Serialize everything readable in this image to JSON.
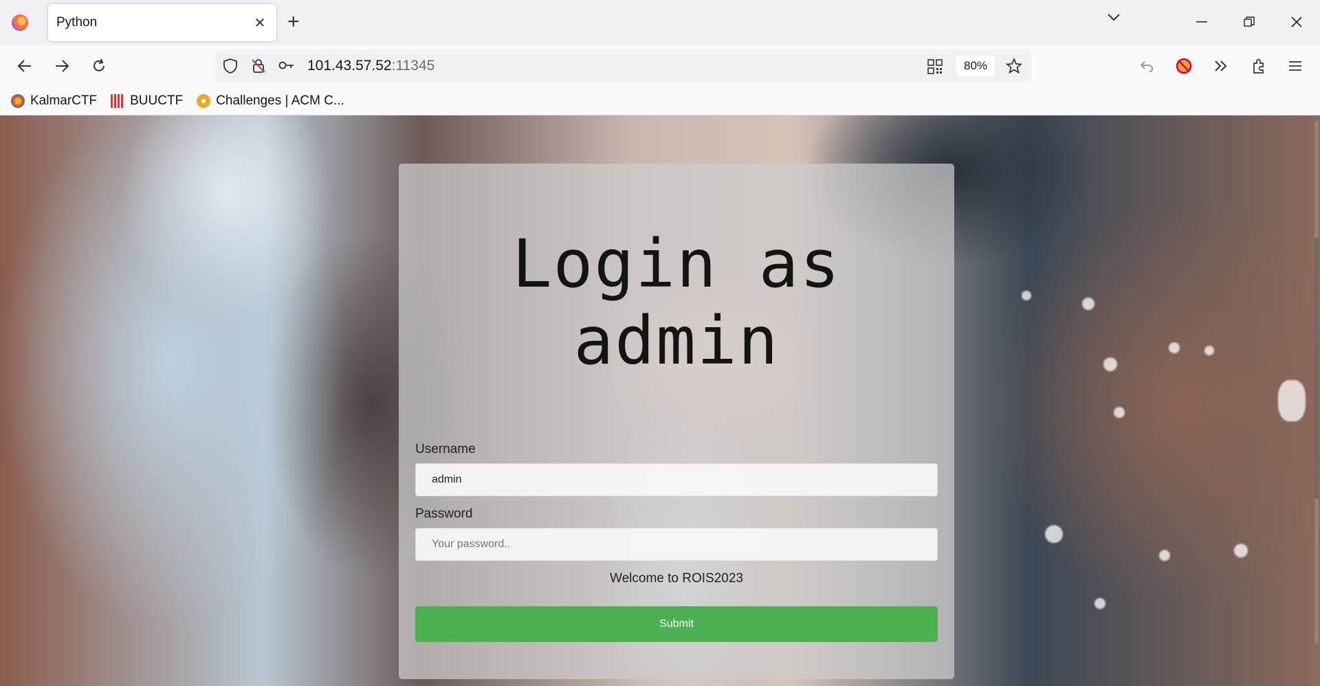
{
  "browser": {
    "tab_title": "Python",
    "url_host": "101.43.57.52",
    "url_port": ":11345",
    "zoom": "80%",
    "bookmarks": [
      {
        "label": "KalmarCTF",
        "icon": "kalmar-icon"
      },
      {
        "label": "BUUCTF",
        "icon": "buuctf-icon"
      },
      {
        "label": "Challenges | ACM C...",
        "icon": "acm-icon"
      }
    ]
  },
  "page": {
    "heading_line1": "Login as",
    "heading_line2": "admin",
    "username_label": "Username",
    "username_value": "admin",
    "password_label": "Password",
    "password_placeholder": "Your password..",
    "welcome": "Welcome to ROIS2023",
    "submit_label": "Submit"
  }
}
